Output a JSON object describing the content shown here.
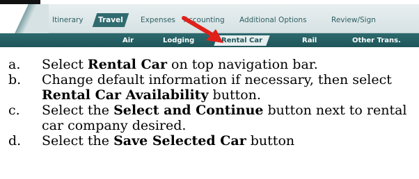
{
  "nav": {
    "top_tabs": [
      {
        "label": "Itinerary",
        "active": false
      },
      {
        "label": "Travel",
        "active": true
      },
      {
        "label": "Expenses",
        "active": false
      },
      {
        "label": "Accounting",
        "active": false
      },
      {
        "label": "Additional Options",
        "active": false
      },
      {
        "label": "Review/Sign",
        "active": false
      }
    ],
    "sub_tabs": [
      {
        "label": "Air",
        "active": false
      },
      {
        "label": "Lodging",
        "active": false
      },
      {
        "label": "Rental Car",
        "active": true
      },
      {
        "label": "Rail",
        "active": false
      },
      {
        "label": "Other Trans.",
        "active": false
      }
    ],
    "colors": {
      "nav_dark": "#1f5559",
      "arrow": "#e0201a"
    },
    "arrow_icon": "red-arrow-icon"
  },
  "steps": [
    {
      "letter": "a.",
      "pre": "Select ",
      "bold": "Rental Car",
      "post": " on top navigation bar."
    },
    {
      "letter": "b.",
      "pre": "Change default information if necessary, then select ",
      "bold": "Rental Car Availability",
      "post": " button."
    },
    {
      "letter": "c.",
      "pre": "Select the ",
      "bold": "Select and Continue",
      "post": " button next to rental car company desired."
    },
    {
      "letter": "d.",
      "pre": "Select the ",
      "bold": "Save Selected Car",
      "post": " button"
    }
  ]
}
